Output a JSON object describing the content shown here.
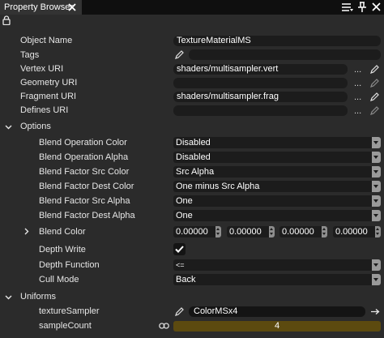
{
  "window": {
    "tab_title": "Property Browser",
    "icons": [
      "close-icon",
      "menu-icon",
      "pin-icon",
      "close-icon",
      "lock-icon"
    ]
  },
  "properties": {
    "object_name": {
      "label": "Object Name",
      "value": "TextureMaterialMS"
    },
    "tags": {
      "label": "Tags",
      "value": ""
    },
    "vertex_uri": {
      "label": "Vertex URI",
      "value": "shaders/multisampler.vert",
      "browse": "..."
    },
    "geometry_uri": {
      "label": "Geometry URI",
      "value": "",
      "browse": "..."
    },
    "fragment_uri": {
      "label": "Fragment URI",
      "value": "shaders/multisampler.frag",
      "browse": "..."
    },
    "defines_uri": {
      "label": "Defines URI",
      "value": "",
      "browse": "..."
    }
  },
  "options": {
    "section_label": "Options",
    "blend_op_color": {
      "label": "Blend Operation Color",
      "value": "Disabled"
    },
    "blend_op_alpha": {
      "label": "Blend Operation Alpha",
      "value": "Disabled"
    },
    "blend_src_color": {
      "label": "Blend Factor Src Color",
      "value": "Src Alpha"
    },
    "blend_dest_color": {
      "label": "Blend Factor Dest Color",
      "value": "One minus Src Alpha"
    },
    "blend_src_alpha": {
      "label": "Blend Factor Src Alpha",
      "value": "One"
    },
    "blend_dest_alpha": {
      "label": "Blend Factor Dest Alpha",
      "value": "One"
    },
    "blend_color": {
      "label": "Blend Color",
      "values": [
        "0.00000",
        "0.00000",
        "0.00000",
        "0.00000"
      ]
    },
    "depth_write": {
      "label": "Depth Write",
      "checked": true
    },
    "depth_function": {
      "label": "Depth Function",
      "value": "<="
    },
    "cull_mode": {
      "label": "Cull Mode",
      "value": "Back"
    }
  },
  "uniforms": {
    "section_label": "Uniforms",
    "texture_sampler": {
      "label": "textureSampler",
      "value": "ColorMSx4"
    },
    "sample_count": {
      "label": "sampleCount",
      "value": "4"
    }
  },
  "colors": {
    "panel_bg": "#2b2b2b",
    "field_bg": "#1c1c1c",
    "title_bg": "#0f0f0f",
    "slider_fill": "#5c4a0f",
    "combo_button": "#9a9a9a"
  }
}
